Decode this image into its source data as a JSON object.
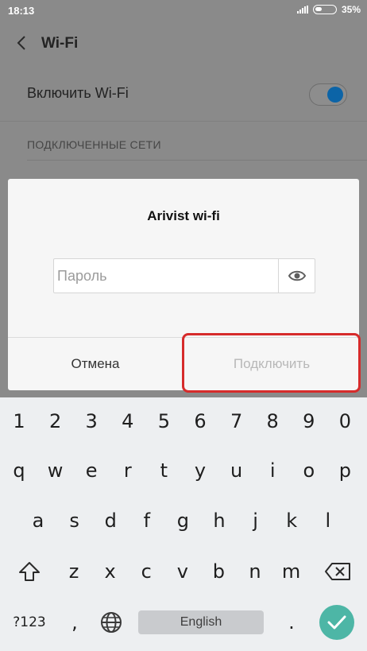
{
  "status_bar": {
    "time": "18:13",
    "battery_text": "35%",
    "battery_level": 0.35
  },
  "header": {
    "title": "Wi-Fi",
    "back_icon": "chevron-left-icon"
  },
  "settings": {
    "wifi_toggle_label": "Включить Wi-Fi",
    "wifi_enabled": true,
    "connected_section": "ПОДКЛЮЧЕННЫЕ СЕТИ"
  },
  "dialog": {
    "title": "Arivist wi-fi",
    "password_placeholder": "Пароль",
    "password_value": "",
    "cancel_label": "Отмена",
    "connect_label": "Подключить",
    "connect_enabled": false
  },
  "keyboard": {
    "row_numbers": [
      "1",
      "2",
      "3",
      "4",
      "5",
      "6",
      "7",
      "8",
      "9",
      "0"
    ],
    "row_top": [
      "q",
      "w",
      "e",
      "r",
      "t",
      "y",
      "u",
      "i",
      "o",
      "p"
    ],
    "row_middle": [
      "a",
      "s",
      "d",
      "f",
      "g",
      "h",
      "j",
      "k",
      "l"
    ],
    "row_bottom": [
      "z",
      "x",
      "c",
      "v",
      "b",
      "n",
      "m"
    ],
    "symbols_label": "?123",
    "comma_label": ",",
    "space_label": "English",
    "period_label": ".",
    "shift_icon": "shift-icon",
    "backspace_icon": "backspace-icon",
    "globe_icon": "globe-icon",
    "enter_icon": "check-icon"
  },
  "colors": {
    "accent_toggle": "#0c64a7",
    "highlight": "#d62b2b",
    "enter_key": "#4db6a6"
  }
}
